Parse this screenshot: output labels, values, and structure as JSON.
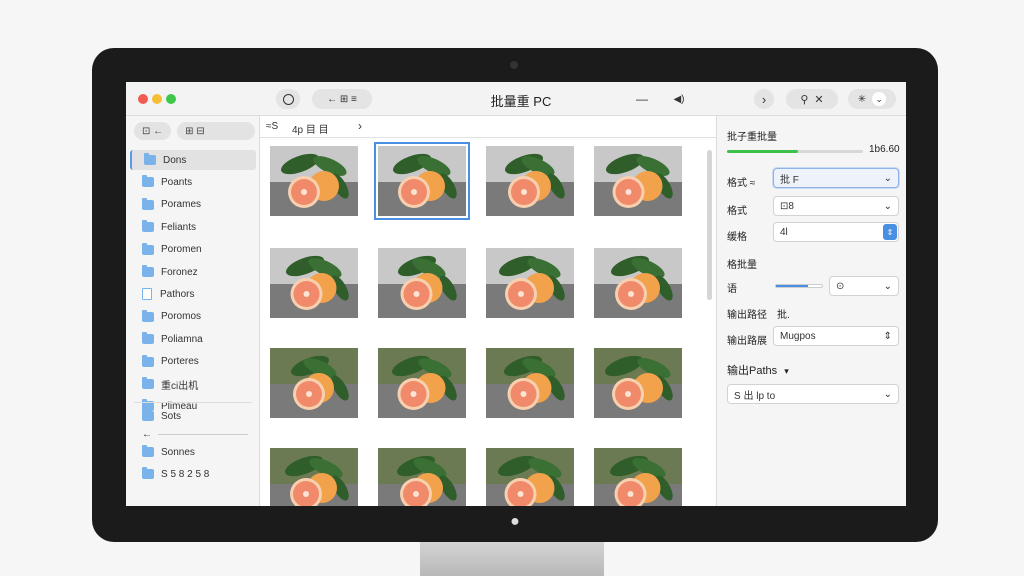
{
  "window": {
    "title": "批量重 PC",
    "toolbar": {
      "nav_glyphs": "← ⊞ ≡",
      "dash": "—",
      "audio": "◀)",
      "chevron_right": "›",
      "search": "⚲",
      "close": "✕",
      "sparkle": "✳",
      "dropdown": "⌄"
    }
  },
  "sidebar": {
    "top_left": "⊡ ←",
    "top_right": "⊞ ⊟",
    "items": [
      {
        "label": "Dons",
        "icon": "folder-icon",
        "active": true
      },
      {
        "label": "Poants",
        "icon": "folder-icon",
        "active": false
      },
      {
        "label": "Porames",
        "icon": "folder-icon",
        "active": false
      },
      {
        "label": "Feliants",
        "icon": "folder-icon",
        "active": false
      },
      {
        "label": "Poromen",
        "icon": "folder-icon",
        "active": false
      },
      {
        "label": "Foronez",
        "icon": "folder-icon",
        "active": false
      },
      {
        "label": "Pathors",
        "icon": "doc-icon",
        "active": false
      },
      {
        "label": "Poromos",
        "icon": "folder-icon",
        "active": false
      },
      {
        "label": "Poliamna",
        "icon": "folder-icon",
        "active": false
      },
      {
        "label": "Porteres",
        "icon": "folder-icon",
        "active": false
      },
      {
        "label": "重ci出机",
        "icon": "folder-icon",
        "active": false
      },
      {
        "label": "Plimeau",
        "icon": "folder-icon",
        "active": false
      }
    ],
    "bottom_items": [
      {
        "label": "Sots",
        "icon": "folder-icon"
      },
      {
        "label": "Sonnes",
        "icon": "folder-icon"
      },
      {
        "label": "S 5 8 2 5 8",
        "icon": "folder-icon"
      }
    ],
    "back_arrow": "←"
  },
  "path_bar": {
    "left": "≈S",
    "crumb": "4p 目 目",
    "chevron": "›"
  },
  "thumbnails": {
    "count_rows": 4,
    "count_cols": 4,
    "selected_index": 1,
    "colors": {
      "fruit": "#f2a24a",
      "flesh": "#f08a6a",
      "leaf": "#2f5e2a",
      "ground": "#7a7a7a",
      "sky": "#c8c8c8"
    }
  },
  "inspector": {
    "section_title": "批子重批量",
    "progress_value": 0.52,
    "progress_text": "1b6.60",
    "rows": [
      {
        "label": "格式 ≈",
        "value": "批 F",
        "control": "select",
        "focused": true
      },
      {
        "label": "格式",
        "value": "⊡8",
        "control": "select",
        "focused": false
      },
      {
        "label": "缓格",
        "value": "4l",
        "control": "stepper",
        "focused": false
      }
    ],
    "section2_title": "格批量",
    "slider_label": "语",
    "slider_value": 0.7,
    "slider_select": "⊙",
    "row_output_label": "输出路径",
    "row_output_value": "批.",
    "row_name_label": "输出路展",
    "row_name_value": "Mugpos",
    "section3_title": "输出Paths",
    "path_value": "S 出 lp to",
    "path_icon": "⌄"
  },
  "colors": {
    "accent": "#4a90e2",
    "progress": "#3cc24a",
    "traffic_red": "#f15b54",
    "traffic_yellow": "#f4bf35",
    "traffic_green": "#3fc64b"
  }
}
